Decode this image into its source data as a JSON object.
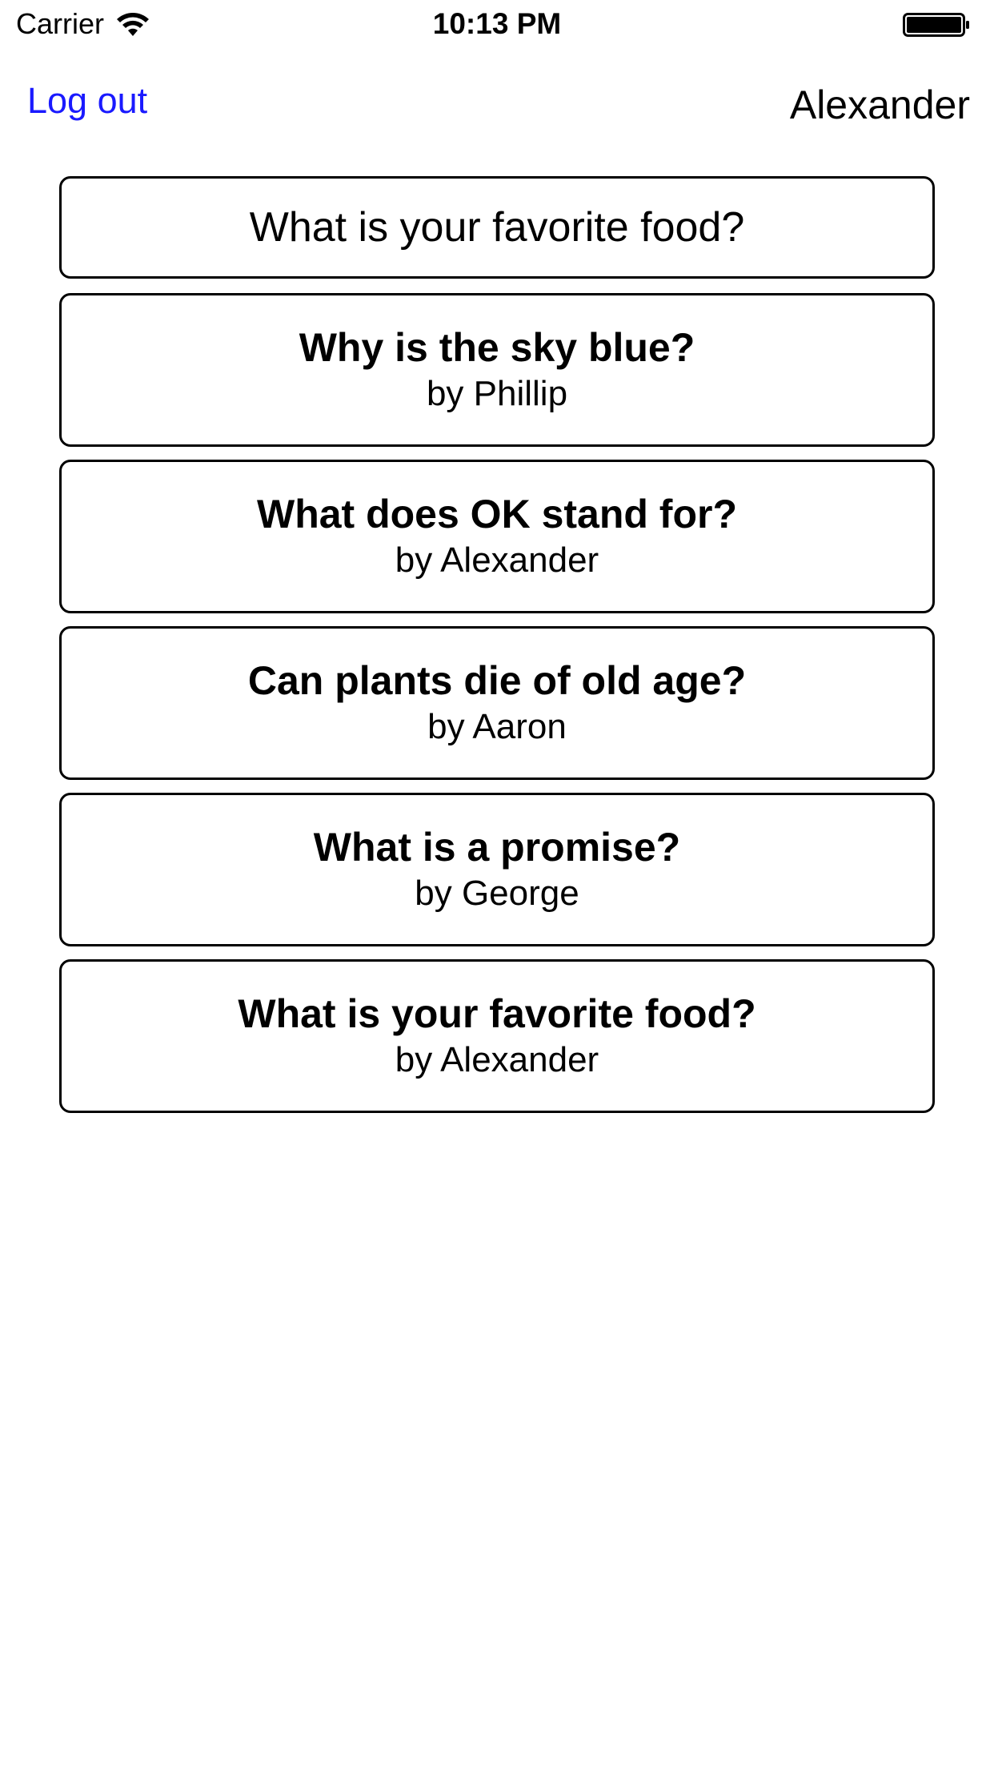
{
  "status_bar": {
    "carrier": "Carrier",
    "time": "10:13 PM",
    "wifi_icon": "wifi-icon",
    "battery_icon": "battery-icon"
  },
  "nav": {
    "logout_label": "Log out",
    "username": "Alexander"
  },
  "new_question": {
    "value": "What is your favorite food?"
  },
  "questions": [
    {
      "title": "Why is the sky blue?",
      "author": "by Phillip"
    },
    {
      "title": "What does OK stand for?",
      "author": "by Alexander"
    },
    {
      "title": "Can plants die of old age?",
      "author": "by Aaron"
    },
    {
      "title": "What is a promise?",
      "author": "by George"
    },
    {
      "title": "What is your favorite food?",
      "author": "by Alexander"
    }
  ],
  "colors": {
    "link": "#1a1aff",
    "border": "#000000",
    "background": "#ffffff"
  }
}
